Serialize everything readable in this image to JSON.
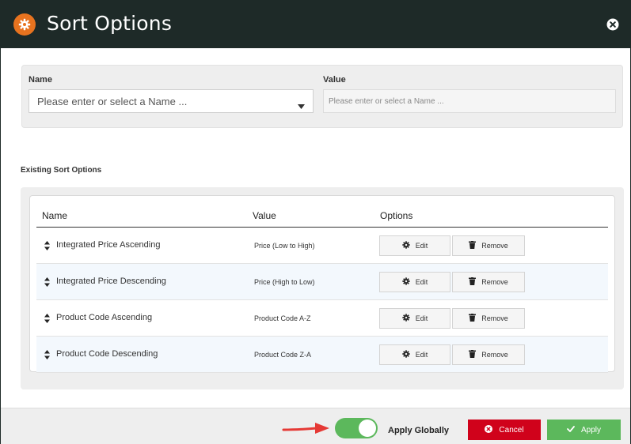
{
  "header": {
    "title": "Sort Options",
    "icon": "gear-icon",
    "close_icon": "close-circle-icon"
  },
  "form": {
    "name_label": "Name",
    "name_placeholder": "Please enter or select a Name ...",
    "value_label": "Value",
    "value_placeholder": "Please enter or select a Name ..."
  },
  "existing": {
    "title": "Existing Sort Options",
    "columns": [
      "Name",
      "Value",
      "Options"
    ],
    "rows": [
      {
        "name": "Integrated Price Ascending",
        "value": "Price (Low to High)"
      },
      {
        "name": "Integrated Price Descending",
        "value": "Price (High to Low)"
      },
      {
        "name": "Product Code Ascending",
        "value": "Product Code A-Z"
      },
      {
        "name": "Product Code Descending",
        "value": "Product Code Z-A"
      }
    ],
    "edit_label": "Edit",
    "remove_label": "Remove"
  },
  "footer": {
    "toggle_label": "Apply Globally",
    "toggle_on": true,
    "cancel_label": "Cancel",
    "apply_label": "Apply"
  },
  "colors": {
    "header_bg": "#1e2a28",
    "accent_orange": "#e8731f",
    "cancel_red": "#d0021b",
    "apply_green": "#5cb85c",
    "arrow_red": "#e53935"
  }
}
